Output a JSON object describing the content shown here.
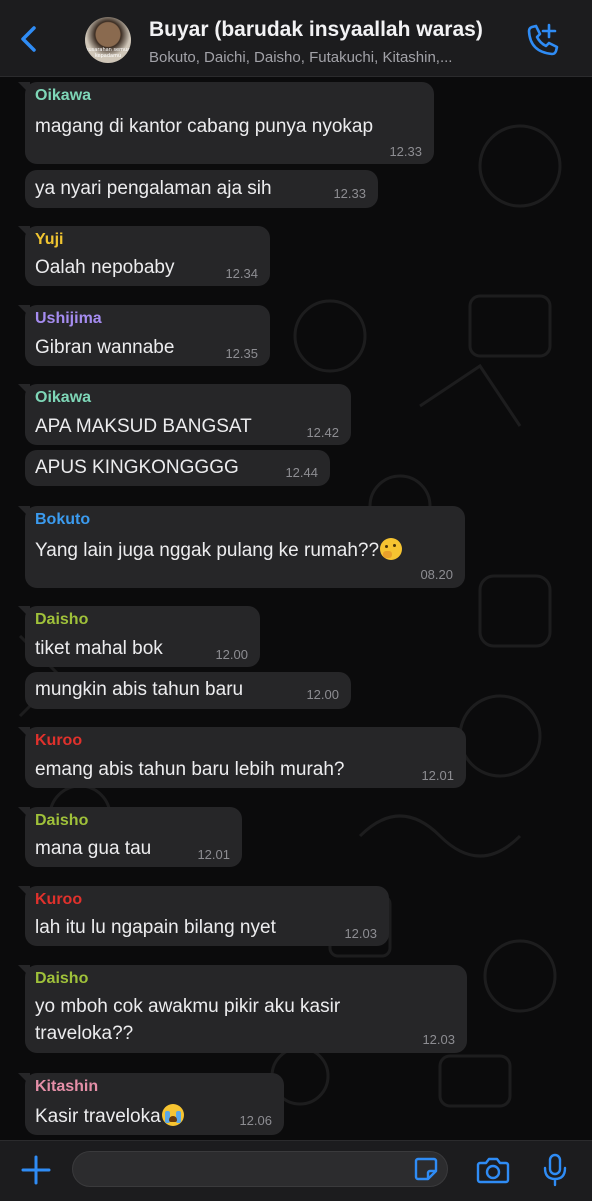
{
  "header": {
    "title": "Buyar (barudak insyaallah waras)",
    "members": "Bokuto, Daichi, Daisho, Futakuchi, Kitashin,...",
    "avatar_caption": "kusarahan semua kepadamu"
  },
  "messages": [
    {
      "sender": "Oikawa",
      "sender_color": "#7ed6b7",
      "lines": [
        "magang di kantor cabang punya nyokap"
      ],
      "time": "12.33"
    },
    {
      "sender": "",
      "lines": [
        "ya nyari pengalaman aja sih"
      ],
      "time": "12.33"
    },
    {
      "sender": "Yuji",
      "sender_color": "#f0c531",
      "lines": [
        "Oalah nepobaby"
      ],
      "time": "12.34"
    },
    {
      "sender": "Ushijima",
      "sender_color": "#a58cf0",
      "lines": [
        "Gibran wannabe"
      ],
      "time": "12.35"
    },
    {
      "sender": "Oikawa",
      "sender_color": "#7ed6b7",
      "lines": [
        "APA MAKSUD BANGSAT"
      ],
      "time": "12.42"
    },
    {
      "sender": "",
      "lines": [
        "APUS KINGKONGGGG"
      ],
      "time": "12.44"
    },
    {
      "sender": "Bokuto",
      "sender_color": "#3b9bef",
      "lines": [
        "Yang lain juga nggak pulang ke rumah??"
      ],
      "emoji": "thinking-face",
      "time": "08.20"
    },
    {
      "sender": "Daisho",
      "sender_color": "#9fc13a",
      "lines": [
        "tiket mahal bok"
      ],
      "time": "12.00"
    },
    {
      "sender": "",
      "lines": [
        "mungkin abis tahun baru"
      ],
      "time": "12.00"
    },
    {
      "sender": "Kuroo",
      "sender_color": "#e0312c",
      "lines": [
        "emang abis tahun baru lebih murah?"
      ],
      "time": "12.01"
    },
    {
      "sender": "Daisho",
      "sender_color": "#9fc13a",
      "lines": [
        "mana gua tau"
      ],
      "time": "12.01"
    },
    {
      "sender": "Kuroo",
      "sender_color": "#e0312c",
      "lines": [
        "lah itu lu ngapain bilang nyet"
      ],
      "time": "12.03"
    },
    {
      "sender": "Daisho",
      "sender_color": "#9fc13a",
      "lines": [
        "yo mboh cok awakmu pikir aku kasir",
        "traveloka??"
      ],
      "time": "12.03"
    },
    {
      "sender": "Kitashin",
      "sender_color": "#e58fa8",
      "lines": [
        "Kasir traveloka"
      ],
      "emoji": "loudly-crying-face",
      "time": "12.06"
    }
  ],
  "footer": {
    "message_value": ""
  }
}
